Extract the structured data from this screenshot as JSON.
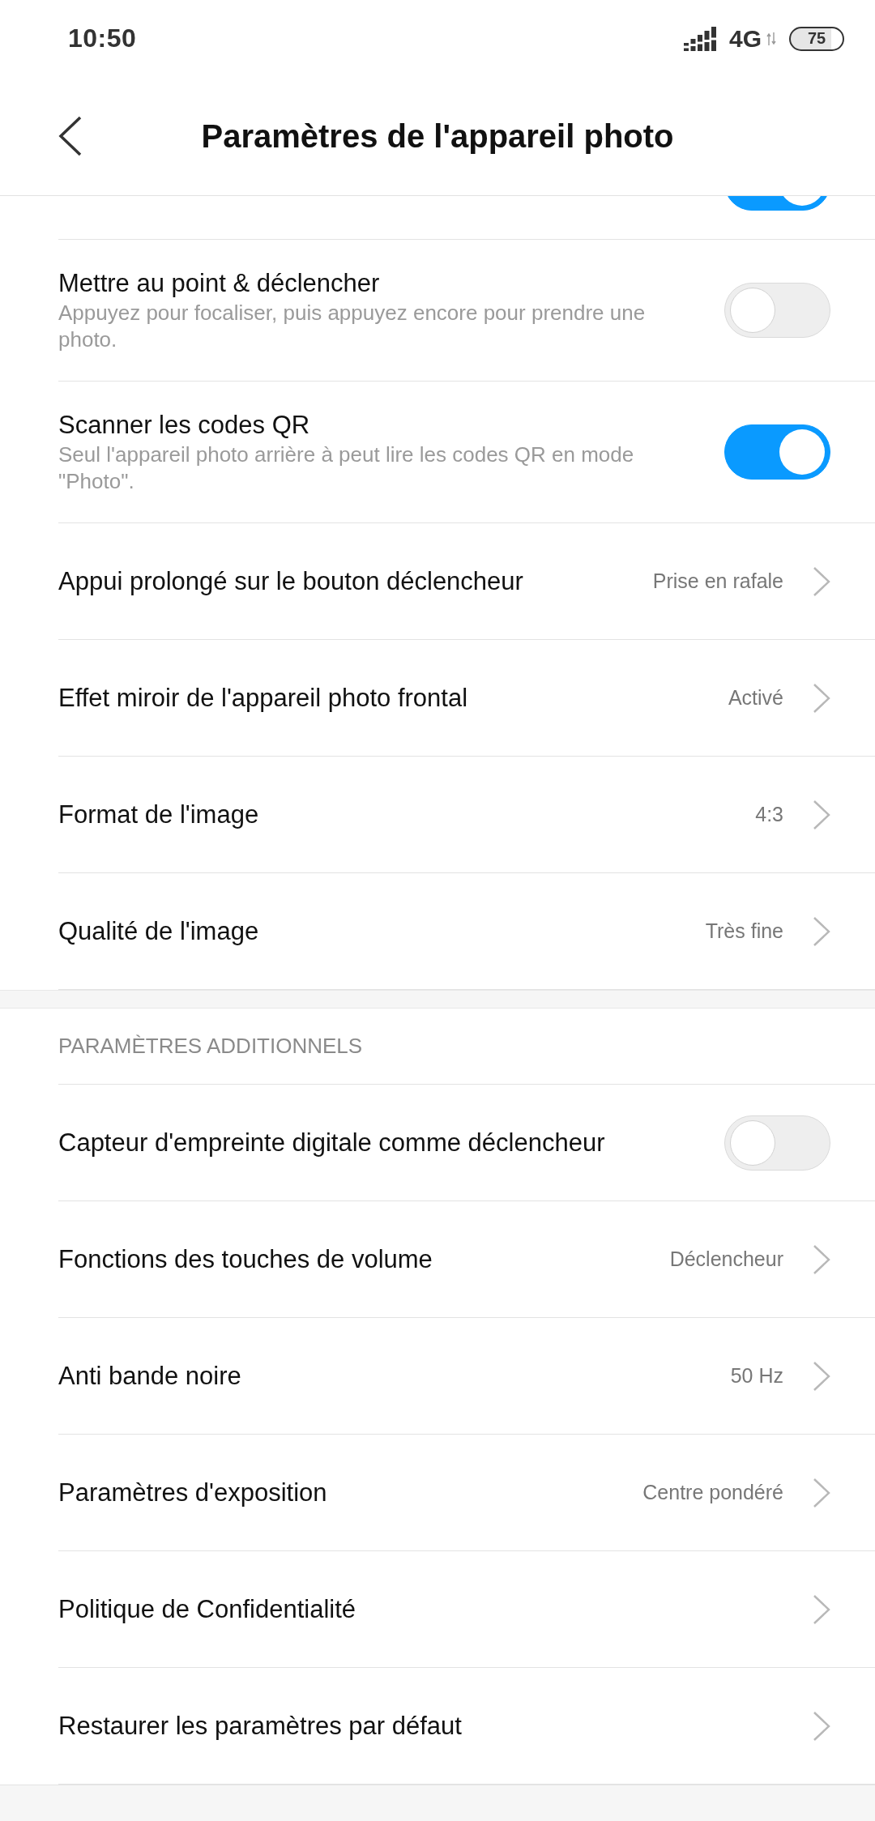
{
  "status_bar": {
    "time": "10:50",
    "network": "4G",
    "battery": "75"
  },
  "header": {
    "title": "Paramètres de l'appareil photo"
  },
  "sections": [
    {
      "items": [
        {
          "kind": "toggle",
          "on": true
        },
        {
          "kind": "toggle",
          "title": "Mettre au point & déclencher",
          "subtitle": "Appuyez pour focaliser, puis appuyez encore pour prendre une photo.",
          "on": false
        },
        {
          "kind": "toggle",
          "title": "Scanner les codes QR",
          "subtitle": "Seul l'appareil photo arrière à peut lire les codes QR en mode \"Photo\".",
          "on": true
        },
        {
          "kind": "value",
          "title": "Appui prolongé sur le bouton déclencheur",
          "value": "Prise en rafale"
        },
        {
          "kind": "value",
          "title": "Effet miroir de l'appareil photo frontal",
          "value": "Activé"
        },
        {
          "kind": "value",
          "title": "Format de l'image",
          "value": "4:3"
        },
        {
          "kind": "value",
          "title": "Qualité de l'image",
          "value": "Très fine"
        }
      ]
    },
    {
      "heading": "PARAMÈTRES ADDITIONNELS",
      "items": [
        {
          "kind": "toggle",
          "title": "Capteur d'empreinte digitale comme déclencheur",
          "on": false
        },
        {
          "kind": "value",
          "title": "Fonctions des touches de volume",
          "value": "Déclencheur"
        },
        {
          "kind": "value",
          "title": "Anti bande noire",
          "value": "50 Hz"
        },
        {
          "kind": "value",
          "title": "Paramètres d'exposition",
          "value": "Centre pondéré"
        },
        {
          "kind": "value",
          "title": "Politique de Confidentialité"
        },
        {
          "kind": "value",
          "title": "Restaurer les paramètres par défaut"
        }
      ]
    }
  ]
}
